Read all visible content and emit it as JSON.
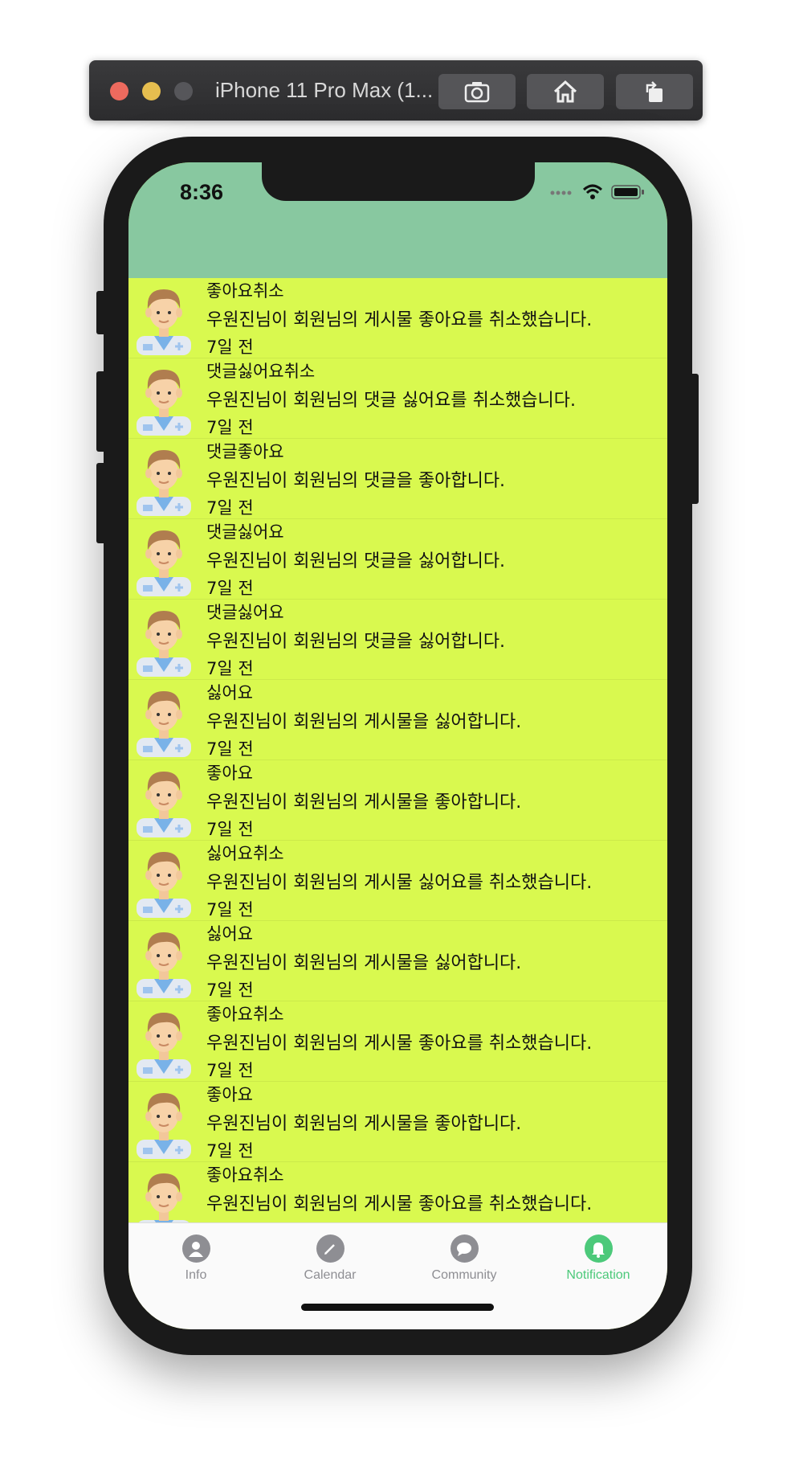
{
  "simulator": {
    "title": "iPhone 11 Pro Max (1...",
    "buttons": [
      "screenshot-icon",
      "home-icon",
      "rotate-icon"
    ]
  },
  "status_bar": {
    "time": "8:36"
  },
  "colors": {
    "header": "#88c8a0",
    "list_background": "#d9f94f",
    "active_tab": "#4cc97a",
    "inactive_tab": "#8e8e93"
  },
  "notifications": [
    {
      "title": "좋아요취소",
      "message": "우원진님이 회원님의 게시물 좋아요를 취소했습니다.",
      "time": "7일 전"
    },
    {
      "title": "댓글싫어요취소",
      "message": "우원진님이 회원님의 댓글 싫어요를 취소했습니다.",
      "time": "7일 전"
    },
    {
      "title": "댓글좋아요",
      "message": "우원진님이 회원님의 댓글을 좋아합니다.",
      "time": "7일 전"
    },
    {
      "title": "댓글싫어요",
      "message": "우원진님이 회원님의 댓글을 싫어합니다.",
      "time": "7일 전"
    },
    {
      "title": "댓글싫어요",
      "message": "우원진님이 회원님의 댓글을 싫어합니다.",
      "time": "7일 전"
    },
    {
      "title": "싫어요",
      "message": "우원진님이 회원님의 게시물을 싫어합니다.",
      "time": "7일 전"
    },
    {
      "title": "좋아요",
      "message": "우원진님이 회원님의 게시물을 좋아합니다.",
      "time": "7일 전"
    },
    {
      "title": "싫어요취소",
      "message": "우원진님이 회원님의 게시물 싫어요를 취소했습니다.",
      "time": "7일 전"
    },
    {
      "title": "싫어요",
      "message": "우원진님이 회원님의 게시물을 싫어합니다.",
      "time": "7일 전"
    },
    {
      "title": "좋아요취소",
      "message": "우원진님이 회원님의 게시물 좋아요를 취소했습니다.",
      "time": "7일 전"
    },
    {
      "title": "좋아요",
      "message": "우원진님이 회원님의 게시물을 좋아합니다.",
      "time": "7일 전"
    },
    {
      "title": "좋아요취소",
      "message": "우원진님이 회원님의 게시물 좋아요를 취소했습니다.",
      "time": ""
    }
  ],
  "tabs": [
    {
      "label": "Info",
      "icon": "person-icon",
      "active": false
    },
    {
      "label": "Calendar",
      "icon": "pencil-icon",
      "active": false
    },
    {
      "label": "Community",
      "icon": "chat-bubble-icon",
      "active": false
    },
    {
      "label": "Notification",
      "icon": "bell-icon",
      "active": true
    }
  ]
}
